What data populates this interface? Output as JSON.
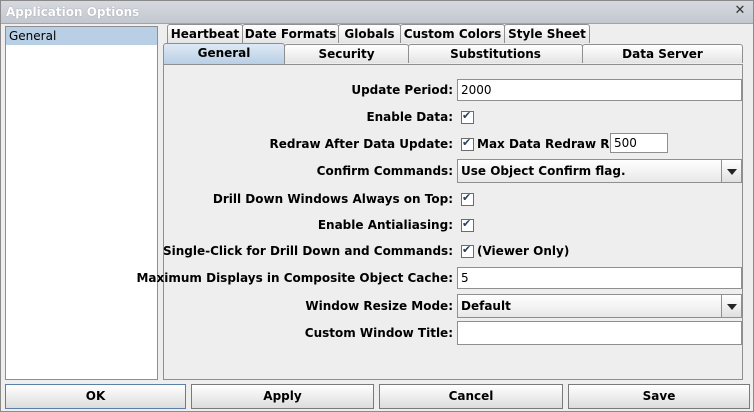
{
  "window": {
    "title": "Application Options",
    "close_glyph": "✕"
  },
  "left_panel": {
    "items": [
      {
        "label": "General",
        "selected": true
      }
    ]
  },
  "tabs": {
    "row1": [
      {
        "label": "Heartbeat"
      },
      {
        "label": "Date Formats"
      },
      {
        "label": "Globals"
      },
      {
        "label": "Custom Colors"
      },
      {
        "label": "Style Sheet"
      }
    ],
    "row2": [
      {
        "label": "General",
        "active": true
      },
      {
        "label": "Security"
      },
      {
        "label": "Substitutions"
      },
      {
        "label": "Data Server"
      }
    ]
  },
  "form": {
    "update_period": {
      "label": "Update Period:",
      "value": "2000"
    },
    "enable_data": {
      "label": "Enable Data:",
      "checked": true
    },
    "redraw_after_update": {
      "label": "Redraw After Data Update:",
      "checked": true,
      "max_rate_label": "Max Data Redraw Rate:",
      "max_rate_value": "500"
    },
    "confirm_commands": {
      "label": "Confirm Commands:",
      "value": "Use Object Confirm flag."
    },
    "drill_down_on_top": {
      "label": "Drill Down Windows Always on Top:",
      "checked": true
    },
    "antialiasing": {
      "label": "Enable Antialiasing:",
      "checked": true
    },
    "single_click": {
      "label": "Single-Click for Drill Down and Commands:",
      "checked": true,
      "note": "(Viewer Only)"
    },
    "max_displays_cache": {
      "label": "Maximum Displays in Composite Object Cache:",
      "value": "5"
    },
    "window_resize_mode": {
      "label": "Window Resize Mode:",
      "value": "Default"
    },
    "custom_window_title": {
      "label": "Custom Window Title:",
      "value": ""
    }
  },
  "buttons": {
    "ok": "OK",
    "apply": "Apply",
    "cancel": "Cancel",
    "save": "Save"
  },
  "colors": {
    "selection": "#b8cfe5",
    "background": "#eeeeee"
  }
}
